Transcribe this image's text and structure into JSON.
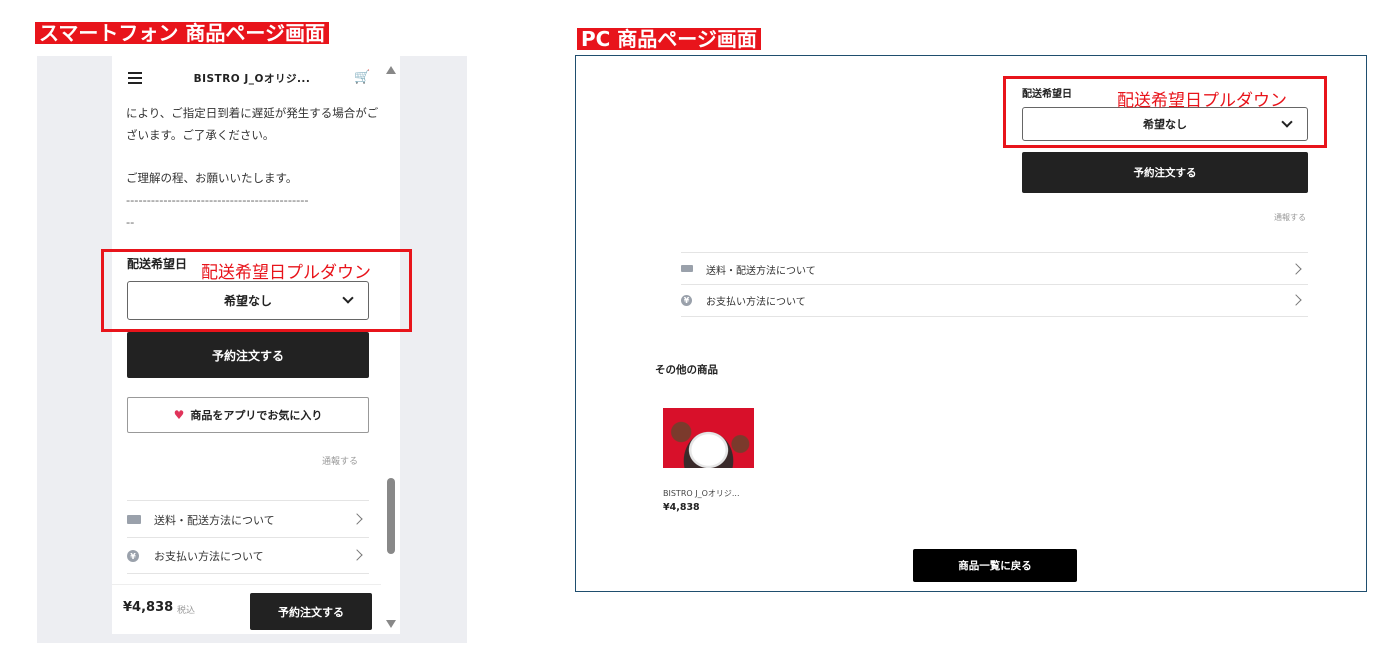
{
  "sp": {
    "section_title": "スマートフォン 商品ページ画面",
    "header": {
      "title": "BISTRO J_Oオリジ...",
      "menu_icon": "menu-icon",
      "cart_icon": "cart-icon"
    },
    "notice_line1": "により、ご指定日到着に遅延が発生する場合がご",
    "notice_line2": "ざいます。ご了承ください。",
    "notice_line3": "ご理解の程、お願いいたします。",
    "dashes1": "--------------------------------------------",
    "dashes2": "--",
    "delivery_label": "配送希望日",
    "annotation": "配送希望日プルダウン",
    "select_value": "希望なし",
    "order_button": "予約注文する",
    "favorite_button": "商品をアプリでお気に入り",
    "report_link": "通報する",
    "shipping_row": "送料・配送方法について",
    "payment_row": "お支払い方法について",
    "price": "¥4,838",
    "tax_label": "税込",
    "bottom_order_button": "予約注文する",
    "accent_color": "#e8141b",
    "heart_color": "#e0335a"
  },
  "pc": {
    "section_title": "PC 商品ページ画面",
    "delivery_label": "配送希望日",
    "annotation": "配送希望日プルダウン",
    "select_value": "希望なし",
    "order_button": "予約注文する",
    "report_link": "通報する",
    "shipping_row": "送料・配送方法について",
    "payment_row": "お支払い方法について",
    "other_products_heading": "その他の商品",
    "product": {
      "name": "BISTRO J_Oオリジ...",
      "price": "¥4,838"
    },
    "back_button": "商品一覧に戻る"
  }
}
